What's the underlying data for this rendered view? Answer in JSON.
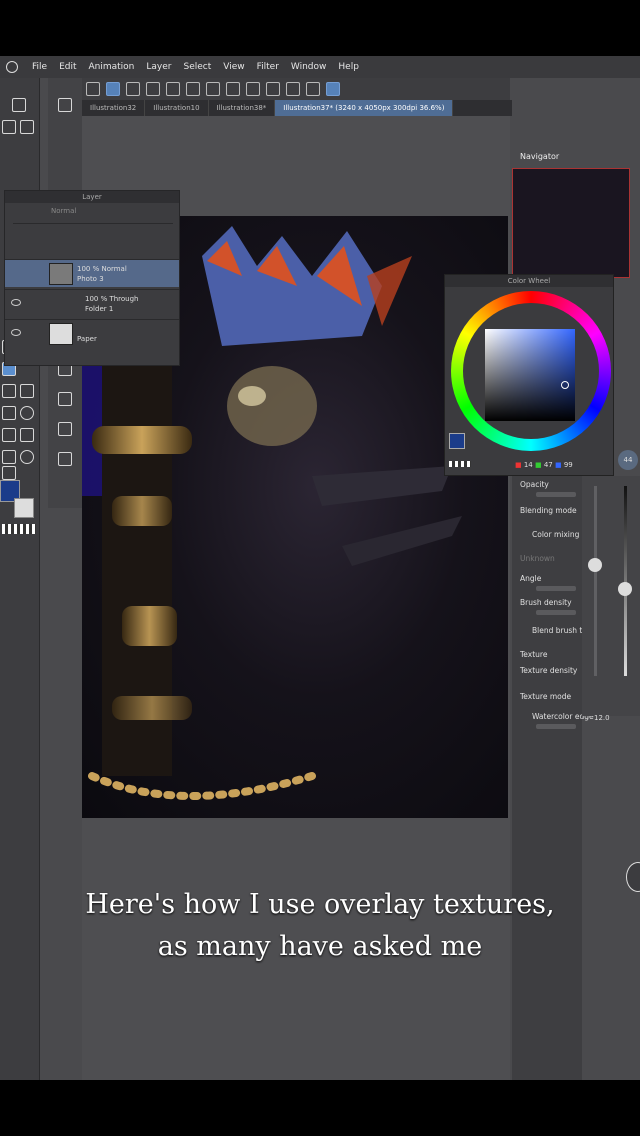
{
  "menu": {
    "items": [
      "File",
      "Edit",
      "Animation",
      "Layer",
      "Select",
      "View",
      "Filter",
      "Window",
      "Help"
    ]
  },
  "tabs": [
    {
      "label": "Illustration32"
    },
    {
      "label": "Illustration10"
    },
    {
      "label": "Illustration38*"
    },
    {
      "label": "Illustration37* (3240 x 4050px 300dpi 36.6%)"
    }
  ],
  "navigator": {
    "title": "Navigator"
  },
  "layer_panel": {
    "title": "Layer",
    "blend_mode": "Normal",
    "layers": [
      {
        "line1": "100 % Normal",
        "line2": "Photo 3"
      },
      {
        "line1": "100 % Through",
        "line2": "Folder 1"
      },
      {
        "line1": "",
        "line2": "Paper"
      }
    ]
  },
  "color_wheel": {
    "title": "Color Wheel",
    "r": "14",
    "g": "47",
    "b": "99",
    "main_color": "#1b3c8a",
    "sub_color": "#dddddd"
  },
  "brush_props": {
    "opacity": "Opacity",
    "blending_mode": "Blending mode",
    "color_mixing": "Color mixing",
    "unknown": "Unknown",
    "angle": "Angle",
    "brush_density": "Brush density",
    "blend_brush_tip": "Blend brush t",
    "texture": "Texture",
    "texture_density": "Texture density",
    "texture_mode": "Texture mode",
    "watercolor_edge": "Watercolor edge",
    "watercolor_value": "12.0",
    "brush_size_value": "44"
  },
  "caption": {
    "line1": "Here's how I use overlay textures,",
    "line2": "as many have asked me"
  }
}
